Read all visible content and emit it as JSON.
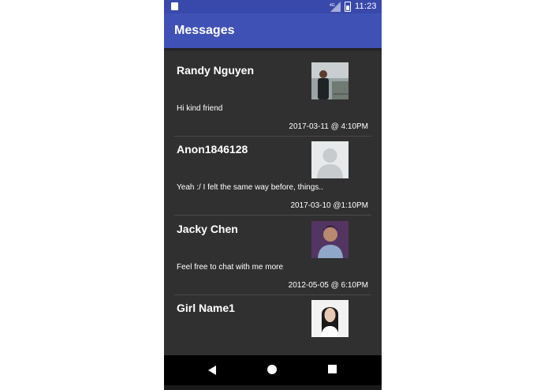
{
  "status_bar": {
    "time": "11:23",
    "signal_label": "4G",
    "left_icon": "sd-card-icon",
    "signal_icon": "signal-icon",
    "battery_icon": "battery-icon"
  },
  "app_bar": {
    "title": "Messages",
    "color": "#3f51b5"
  },
  "messages": [
    {
      "name": "Randy Nguyen",
      "preview": "Hi kind friend",
      "date": "2017-03-11 @ 4:10PM",
      "avatar": "avatar-photo-icon"
    },
    {
      "name": "Anon1846128",
      "preview": "Yeah :/ I felt the same way before, things..",
      "date": "2017-03-10 @1:10PM",
      "avatar": "default-avatar-icon"
    },
    {
      "name": "Jacky Chen",
      "preview": "Feel free to chat with me more",
      "date": "2012-05-05 @ 6:10PM",
      "avatar": "avatar-photo-icon"
    },
    {
      "name": "Girl Name1",
      "preview": "",
      "date": "",
      "avatar": "avatar-photo-icon"
    }
  ],
  "nav_bar": {
    "back_icon": "back-icon",
    "home_icon": "home-icon",
    "recents_icon": "recents-icon"
  }
}
